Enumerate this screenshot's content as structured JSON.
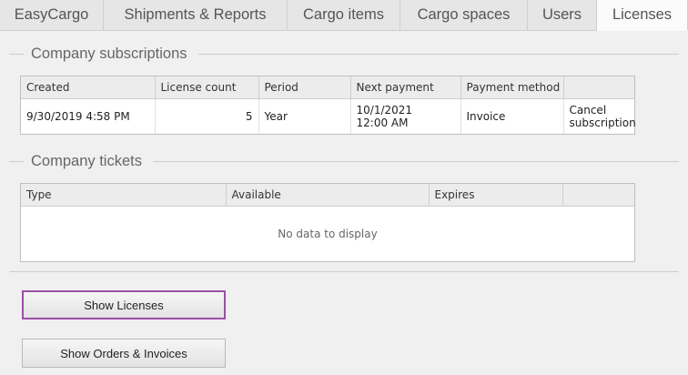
{
  "tabs": [
    {
      "label": "EasyCargo",
      "active": false
    },
    {
      "label": "Shipments & Reports",
      "active": false
    },
    {
      "label": "Cargo items",
      "active": false
    },
    {
      "label": "Cargo spaces",
      "active": false
    },
    {
      "label": "Users",
      "active": false
    },
    {
      "label": "Licenses",
      "active": true
    }
  ],
  "subscriptions": {
    "title": "Company subscriptions",
    "columns": [
      "Created",
      "License count",
      "Period",
      "Next payment",
      "Payment method",
      ""
    ],
    "rows": [
      {
        "created": "9/30/2019 4:58 PM",
        "license_count": "5",
        "period": "Year",
        "next_payment_date": "10/1/2021",
        "next_payment_time": "12:00 AM",
        "payment_method": "Invoice",
        "action_line1": "Cancel",
        "action_line2": "subscription"
      }
    ]
  },
  "tickets": {
    "title": "Company tickets",
    "columns": [
      "Type",
      "Available",
      "Expires",
      ""
    ],
    "empty_text": "No data to display"
  },
  "buttons": {
    "show_licenses": "Show Licenses",
    "show_orders": "Show Orders & Invoices"
  }
}
